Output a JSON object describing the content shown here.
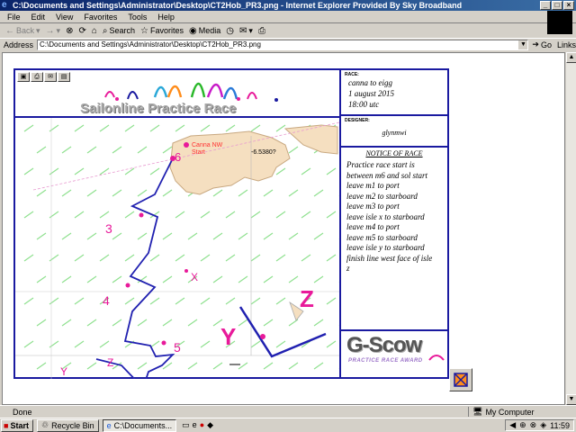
{
  "window": {
    "title": "C:\\Documents and Settings\\Administrator\\Desktop\\CT2Hob_PR3.png - Internet Explorer Provided By Sky Broadband"
  },
  "menu": [
    "File",
    "Edit",
    "View",
    "Favorites",
    "Tools",
    "Help"
  ],
  "toolbar": {
    "back": "Back",
    "search": "Search",
    "favorites": "Favorites",
    "media": "Media"
  },
  "address": {
    "label": "Address",
    "value": "C:\\Documents and Settings\\Administrator\\Desktop\\CT2Hob_PR3.png",
    "go": "Go",
    "links": "Links"
  },
  "page": {
    "banner": "Sailonline Practice Race",
    "race_label": "RACE:",
    "race_lines": [
      "canna to eigg",
      "1 august 2015",
      "18:00 utc"
    ],
    "designer_label": "DESIGNER:",
    "designer": "glynmwi",
    "notice_title": "NOTICE OF RACE",
    "notice_lines": [
      "Practice race start is",
      "between m6 and sol start",
      "leave m1 to port",
      "leave m2 to starboard",
      "leave m3 to port",
      "leave isle x to starboard",
      "leave m4 to port",
      "leave m5 to starboard",
      "leave isle y to starboard",
      "finish line west face of isle",
      "z"
    ],
    "logo_main": "G-Scow",
    "logo_sub": "PRACTICE RACE AWARD",
    "map": {
      "start_label_1": "Canna NW",
      "start_label_2": "Start",
      "coord": "-6.5380?",
      "marks": [
        "6",
        "3",
        "4",
        "5",
        "X",
        "Y",
        "Z"
      ],
      "inset_marks": [
        "Y",
        "Z"
      ]
    }
  },
  "status": {
    "left": "Done",
    "zone": "My Computer"
  },
  "taskbar": {
    "start": "Start",
    "recycle": "Recycle Bin",
    "window": "C:\\Documents...",
    "clock": "11:59"
  }
}
